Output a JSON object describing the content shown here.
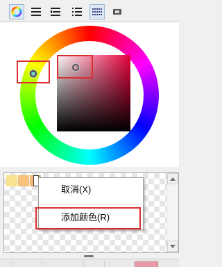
{
  "toolbar": {
    "buttons": [
      {
        "name": "color-wheel-tab",
        "icon": "color-wheel-icon",
        "active": true
      },
      {
        "name": "rgb-sliders-tab",
        "icon": "horizontal-bars-icon",
        "active": false
      },
      {
        "name": "hsv-sliders-tab",
        "icon": "sliders-icon",
        "active": false
      },
      {
        "name": "color-set-list-tab",
        "icon": "list-icon",
        "active": false
      },
      {
        "name": "color-set-grid-tab",
        "icon": "grid-palette-icon",
        "active": true
      },
      {
        "name": "intermediate-color-tab",
        "icon": "gradient-icon",
        "active": false
      }
    ]
  },
  "color_picker": {
    "current_color": "#e8003c",
    "hue_marker_color": "#7fd2c6"
  },
  "swatches": [
    {
      "color": "#fbe28e"
    },
    {
      "color": "#f6c07d"
    },
    {
      "color": "#f3b775"
    }
  ],
  "context_menu": {
    "items": [
      {
        "label": "取消(X)"
      },
      {
        "label": "添加颜色(R)"
      }
    ]
  },
  "colors": {
    "highlight": "#d9302f",
    "bottom_swatch": "#e79aa4"
  }
}
